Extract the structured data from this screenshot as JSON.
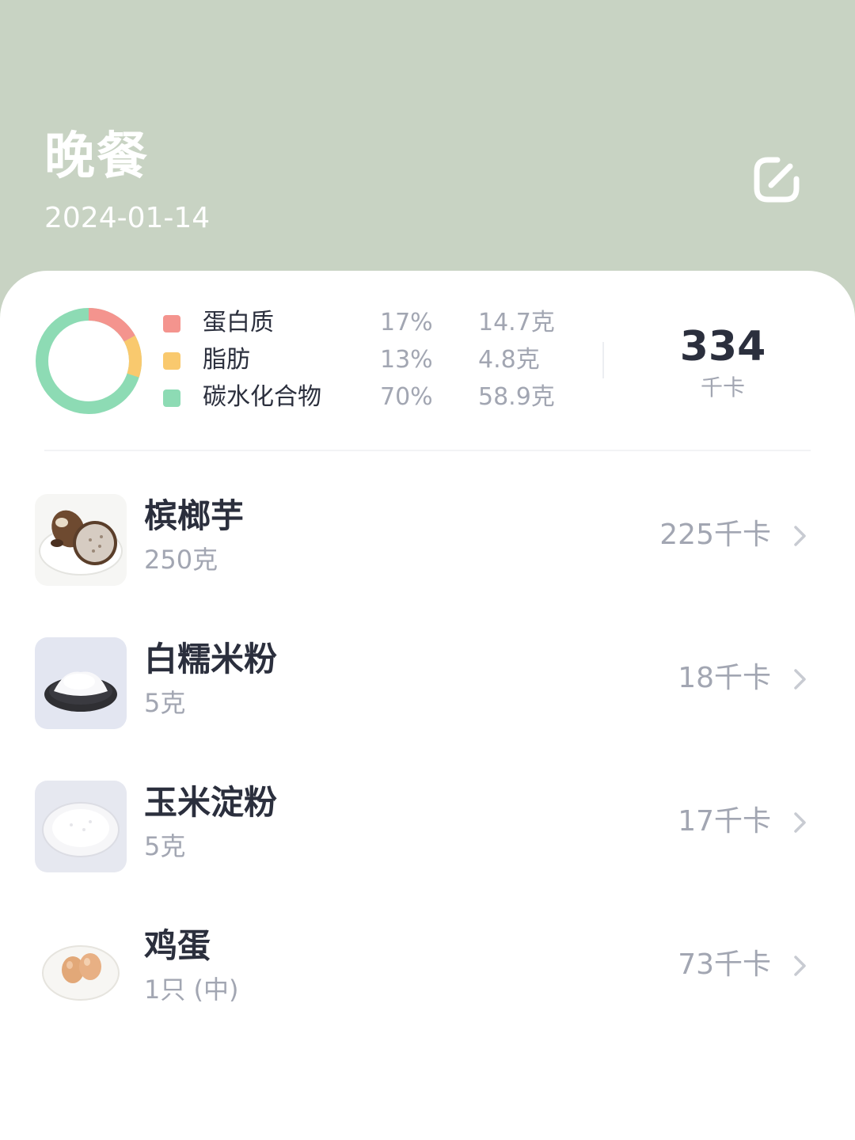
{
  "header": {
    "title": "晚餐",
    "date": "2024-01-14",
    "edit_icon": "edit-icon"
  },
  "summary": {
    "macros": [
      {
        "name": "蛋白质",
        "percent": "17%",
        "grams": "14.7克",
        "color": "#f4948e"
      },
      {
        "name": "脂肪",
        "percent": "13%",
        "grams": "4.8克",
        "color": "#f9c96e"
      },
      {
        "name": "碳水化合物",
        "percent": "70%",
        "grams": "58.9克",
        "color": "#8ddbb4"
      }
    ],
    "total_value": "334",
    "total_unit": "千卡"
  },
  "foods": [
    {
      "name": "槟榔芋",
      "amount": "250克",
      "kcal": "225千卡",
      "image": "taro-image"
    },
    {
      "name": "白糯米粉",
      "amount": "5克",
      "kcal": "18千卡",
      "image": "glutinous-rice-flour-image"
    },
    {
      "name": "玉米淀粉",
      "amount": "5克",
      "kcal": "17千卡",
      "image": "corn-starch-image"
    },
    {
      "name": "鸡蛋",
      "amount": "1只 (中)",
      "kcal": "73千卡",
      "image": "egg-image"
    }
  ],
  "colors": {
    "header_bg": "#c8d3c3",
    "text_primary": "#2b2f3d",
    "text_secondary": "#a2a6b2"
  }
}
